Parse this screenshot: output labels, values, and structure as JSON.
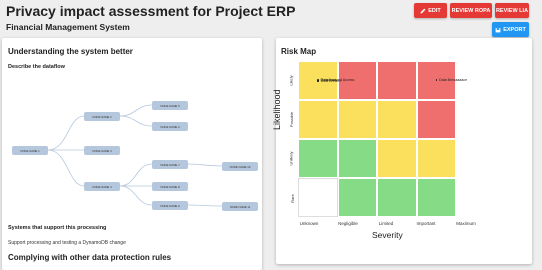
{
  "header": {
    "title": "Privacy impact assessment for Project ERP",
    "subtitle": "Financial Management System",
    "edit_label": "EDIT",
    "review_ropa_label": "REVIEW ROPA",
    "review_lia_label": "REVIEW LIA",
    "export_label": "EXPORT",
    "colors": {
      "danger": "#e53935",
      "primary": "#2196f3"
    }
  },
  "left": {
    "heading": "Understanding the system better",
    "dataflow_heading": "Describe the dataflow",
    "nodes": [
      "NODE NAME 1",
      "NODE NAME 2",
      "NODE NAME 3",
      "NODE NAME 4",
      "NODE NAME 5",
      "NODE NAME 6",
      "NODE NAME 7",
      "NODE NAME 8",
      "NODE NAME 9",
      "NODE NAME 10",
      "NODE NAME 11"
    ],
    "systems_heading": "Systems that support this processing",
    "systems_text": "Support processing and testing a DynamoDB change",
    "complying_heading": "Complying with other data protection rules"
  },
  "risk_map": {
    "title": "Risk Map",
    "y_axis_label": "Likelihood",
    "x_axis_label": "Severity",
    "y_ticks": [
      "Likely",
      "Possible",
      "Unlikely",
      "Rare"
    ],
    "x_ticks": [
      "Unknown",
      "Negligible",
      "Limited",
      "Important",
      "Maximum"
    ],
    "matrix_colors": [
      [
        "yellow",
        "red",
        "red",
        "red"
      ],
      [
        "yellow",
        "yellow",
        "yellow",
        "red"
      ],
      [
        "green",
        "green",
        "yellow",
        "yellow"
      ],
      [
        "white",
        "green",
        "green",
        "green"
      ]
    ],
    "points": [
      {
        "label": "Unauthorized Access",
        "likelihood": "Likely",
        "severity": "Unknown"
      },
      {
        "label": "Data Loss",
        "likelihood": "Likely",
        "severity": "Unknown"
      },
      {
        "label": "Data Breach",
        "likelihood": "Likely",
        "severity": "Unknown"
      },
      {
        "label": "Data Breaaaaace",
        "likelihood": "Likely",
        "severity": "Important"
      }
    ]
  }
}
